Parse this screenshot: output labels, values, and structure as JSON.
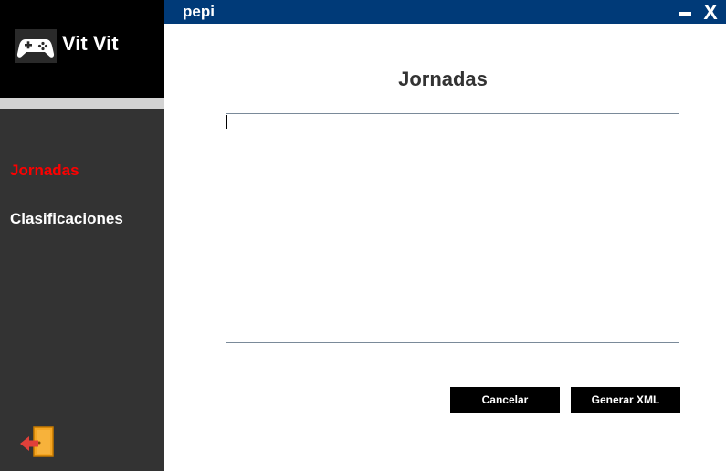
{
  "app": {
    "name": "Vit Vit",
    "logo_icon": "gamepad-icon"
  },
  "titlebar": {
    "user": "pepi",
    "minimize_icon": "minimize-icon",
    "close_label": "X",
    "color": "#003a78"
  },
  "sidebar": {
    "items": [
      {
        "label": "Jornadas",
        "active": true,
        "color": "#ff0000"
      },
      {
        "label": "Clasificaciones",
        "active": false,
        "color": "#ffffff"
      }
    ],
    "logout_icon": "logout-door-icon",
    "background": "#333333"
  },
  "main": {
    "title": "Jornadas",
    "text_value": "",
    "buttons": {
      "cancel_label": "Cancelar",
      "generate_label": "Generar XML"
    }
  }
}
